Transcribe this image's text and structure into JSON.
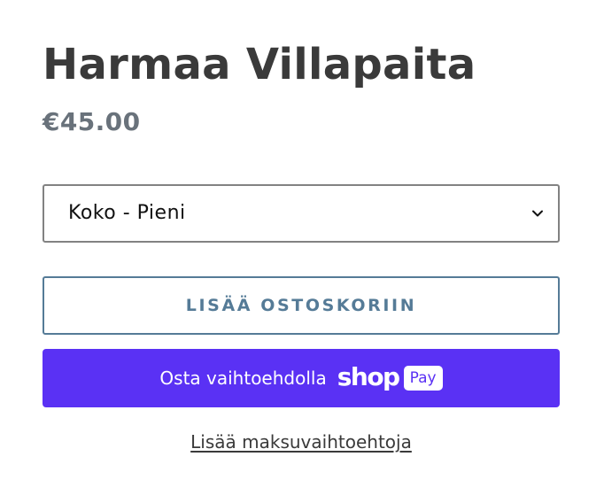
{
  "product": {
    "title": "Harmaa Villapaita",
    "price": "€45.00"
  },
  "variant_select": {
    "selected_value": "Koko - Pieni",
    "icon": "chevron-down-icon"
  },
  "buttons": {
    "add_to_cart_label": "LISÄÄ OSTOSKORIIN",
    "shop_pay_prefix": "Osta vaihtoehdolla",
    "shop_pay_brand": "shop",
    "shop_pay_badge": "Pay",
    "more_payment_options": "Lisää maksuvaihtoehtoja"
  },
  "colors": {
    "title": "#3a3a3a",
    "price": "#69727b",
    "accent": "#557b97",
    "shop_pay": "#5a31f4"
  }
}
